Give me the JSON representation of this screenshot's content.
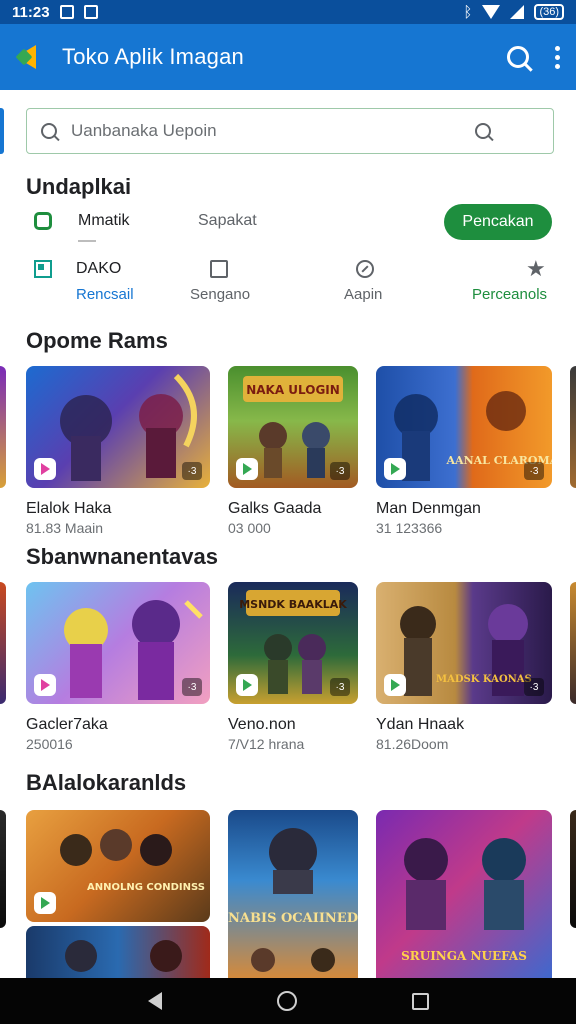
{
  "status_bar": {
    "time": "11:23",
    "battery": "(36)"
  },
  "app_bar": {
    "title": "Toko Aplik Imagan"
  },
  "search": {
    "placeholder": "Uanbanaka Uepoin"
  },
  "sections": {
    "featured": {
      "title": "Undaplkai",
      "chip_primary": "Mmatik",
      "chip_secondary": "Sapakat",
      "action_button": "Pencakan"
    },
    "filters": {
      "first_value": "DAKO",
      "labels": [
        "Rencsail",
        "Sengano",
        "Aapin",
        "Perceanols"
      ]
    },
    "popular": {
      "title": "Opome Rams",
      "items": [
        {
          "title": "Elalok Haka",
          "subtitle": "81.83 Maain"
        },
        {
          "title": "Galks Gaada",
          "subtitle": "03 000"
        },
        {
          "title": "Man Denmgan",
          "subtitle": "31 123366"
        }
      ]
    },
    "special": {
      "title": "Sbanwnanentavas",
      "items": [
        {
          "title": "Gacler7aka",
          "subtitle": "250016"
        },
        {
          "title": "Veno.non",
          "subtitle": "7/V12 hrana"
        },
        {
          "title": "Ydan Hnaak",
          "subtitle": "81.26Doom"
        }
      ]
    },
    "more": {
      "title": "BAlalokaranlds"
    }
  },
  "thumb_text": {
    "galks": "NAKA ULOGIN",
    "man": "AANAL CLAROMAY",
    "veno": "MSNDK BAAKLAK",
    "ydan": "MADSK KAONAS",
    "more1": "ANNOLNG CONDINSS",
    "more2": "NABIS OCAIINED",
    "more3": "SRUINGA NUEFAS"
  },
  "colors": {
    "status_bar": "#0a4f9c",
    "app_bar": "#1676d2",
    "accent_green": "#1e8e3e",
    "link_blue": "#1676d2",
    "nav_bar": "#050505"
  },
  "icons": {
    "back": "back-icon",
    "search": "search-icon",
    "menu": "more-vert-icon",
    "home": "home-icon"
  }
}
